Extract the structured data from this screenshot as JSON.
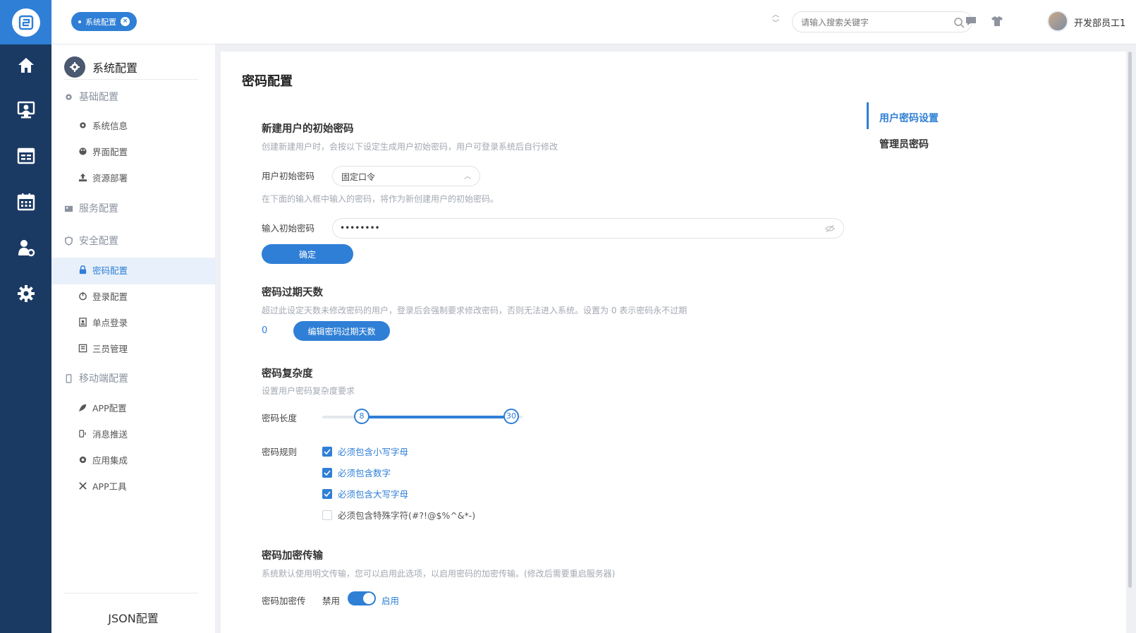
{
  "topbar": {
    "active_tab": "系统配置",
    "search_placeholder": "请输入搜索关键字",
    "username": "开发部员工1"
  },
  "sidebar": {
    "title": "系统配置",
    "groups": {
      "basic": "基础配置",
      "basic_items": [
        "系统信息",
        "界面配置",
        "资源部署"
      ],
      "service": "服务配置",
      "security": "安全配置",
      "security_items": [
        "密码配置",
        "登录配置",
        "单点登录",
        "三员管理"
      ],
      "mobile": "移动端配置",
      "mobile_items": [
        "APP配置",
        "消息推送",
        "应用集成",
        "APP工具"
      ]
    },
    "footer": "JSON配置"
  },
  "main": {
    "title": "密码配置",
    "initial": {
      "title": "新建用户的初始密码",
      "desc": "创建新建用户时，会按以下设定生成用户初始密码，用户可登录系统后自行修改",
      "type_label": "用户初始密码",
      "type_value": "固定口令",
      "hint": "在下面的输入框中输入的密码，将作为新创建用户的初始密码。",
      "pwd_label": "输入初始密码",
      "pwd_value": "••••••••",
      "confirm": "确定"
    },
    "expiry": {
      "title": "密码过期天数",
      "desc": "超过此设定天数未修改密码的用户，登录后会强制要求修改密码，否则无法进入系统。设置为 0 表示密码永不过期",
      "value": "0",
      "edit": "编辑密码过期天数"
    },
    "complexity": {
      "title": "密码复杂度",
      "desc": "设置用户密码复杂度要求",
      "length_label": "密码长度",
      "length_min": "8",
      "length_max": "30",
      "rules_label": "密码规则",
      "rules": [
        {
          "label": "必须包含小写字母",
          "checked": true
        },
        {
          "label": "必须包含数字",
          "checked": true
        },
        {
          "label": "必须包含大写字母",
          "checked": true
        },
        {
          "label": "必须包含特殊字符(#?!@$%^&*-)",
          "checked": false
        }
      ]
    },
    "encrypt": {
      "title": "密码加密传输",
      "desc": "系统默认使用明文传输，您可以启用此选项，以启用密码的加密传输。(修改后需要重启服务器)",
      "label": "密码加密传",
      "off": "禁用",
      "on": "启用"
    }
  },
  "anchors": [
    "用户密码设置",
    "管理员密码"
  ],
  "colors": {
    "accent": "#2f7fd6",
    "rail": "#1b3a63"
  }
}
